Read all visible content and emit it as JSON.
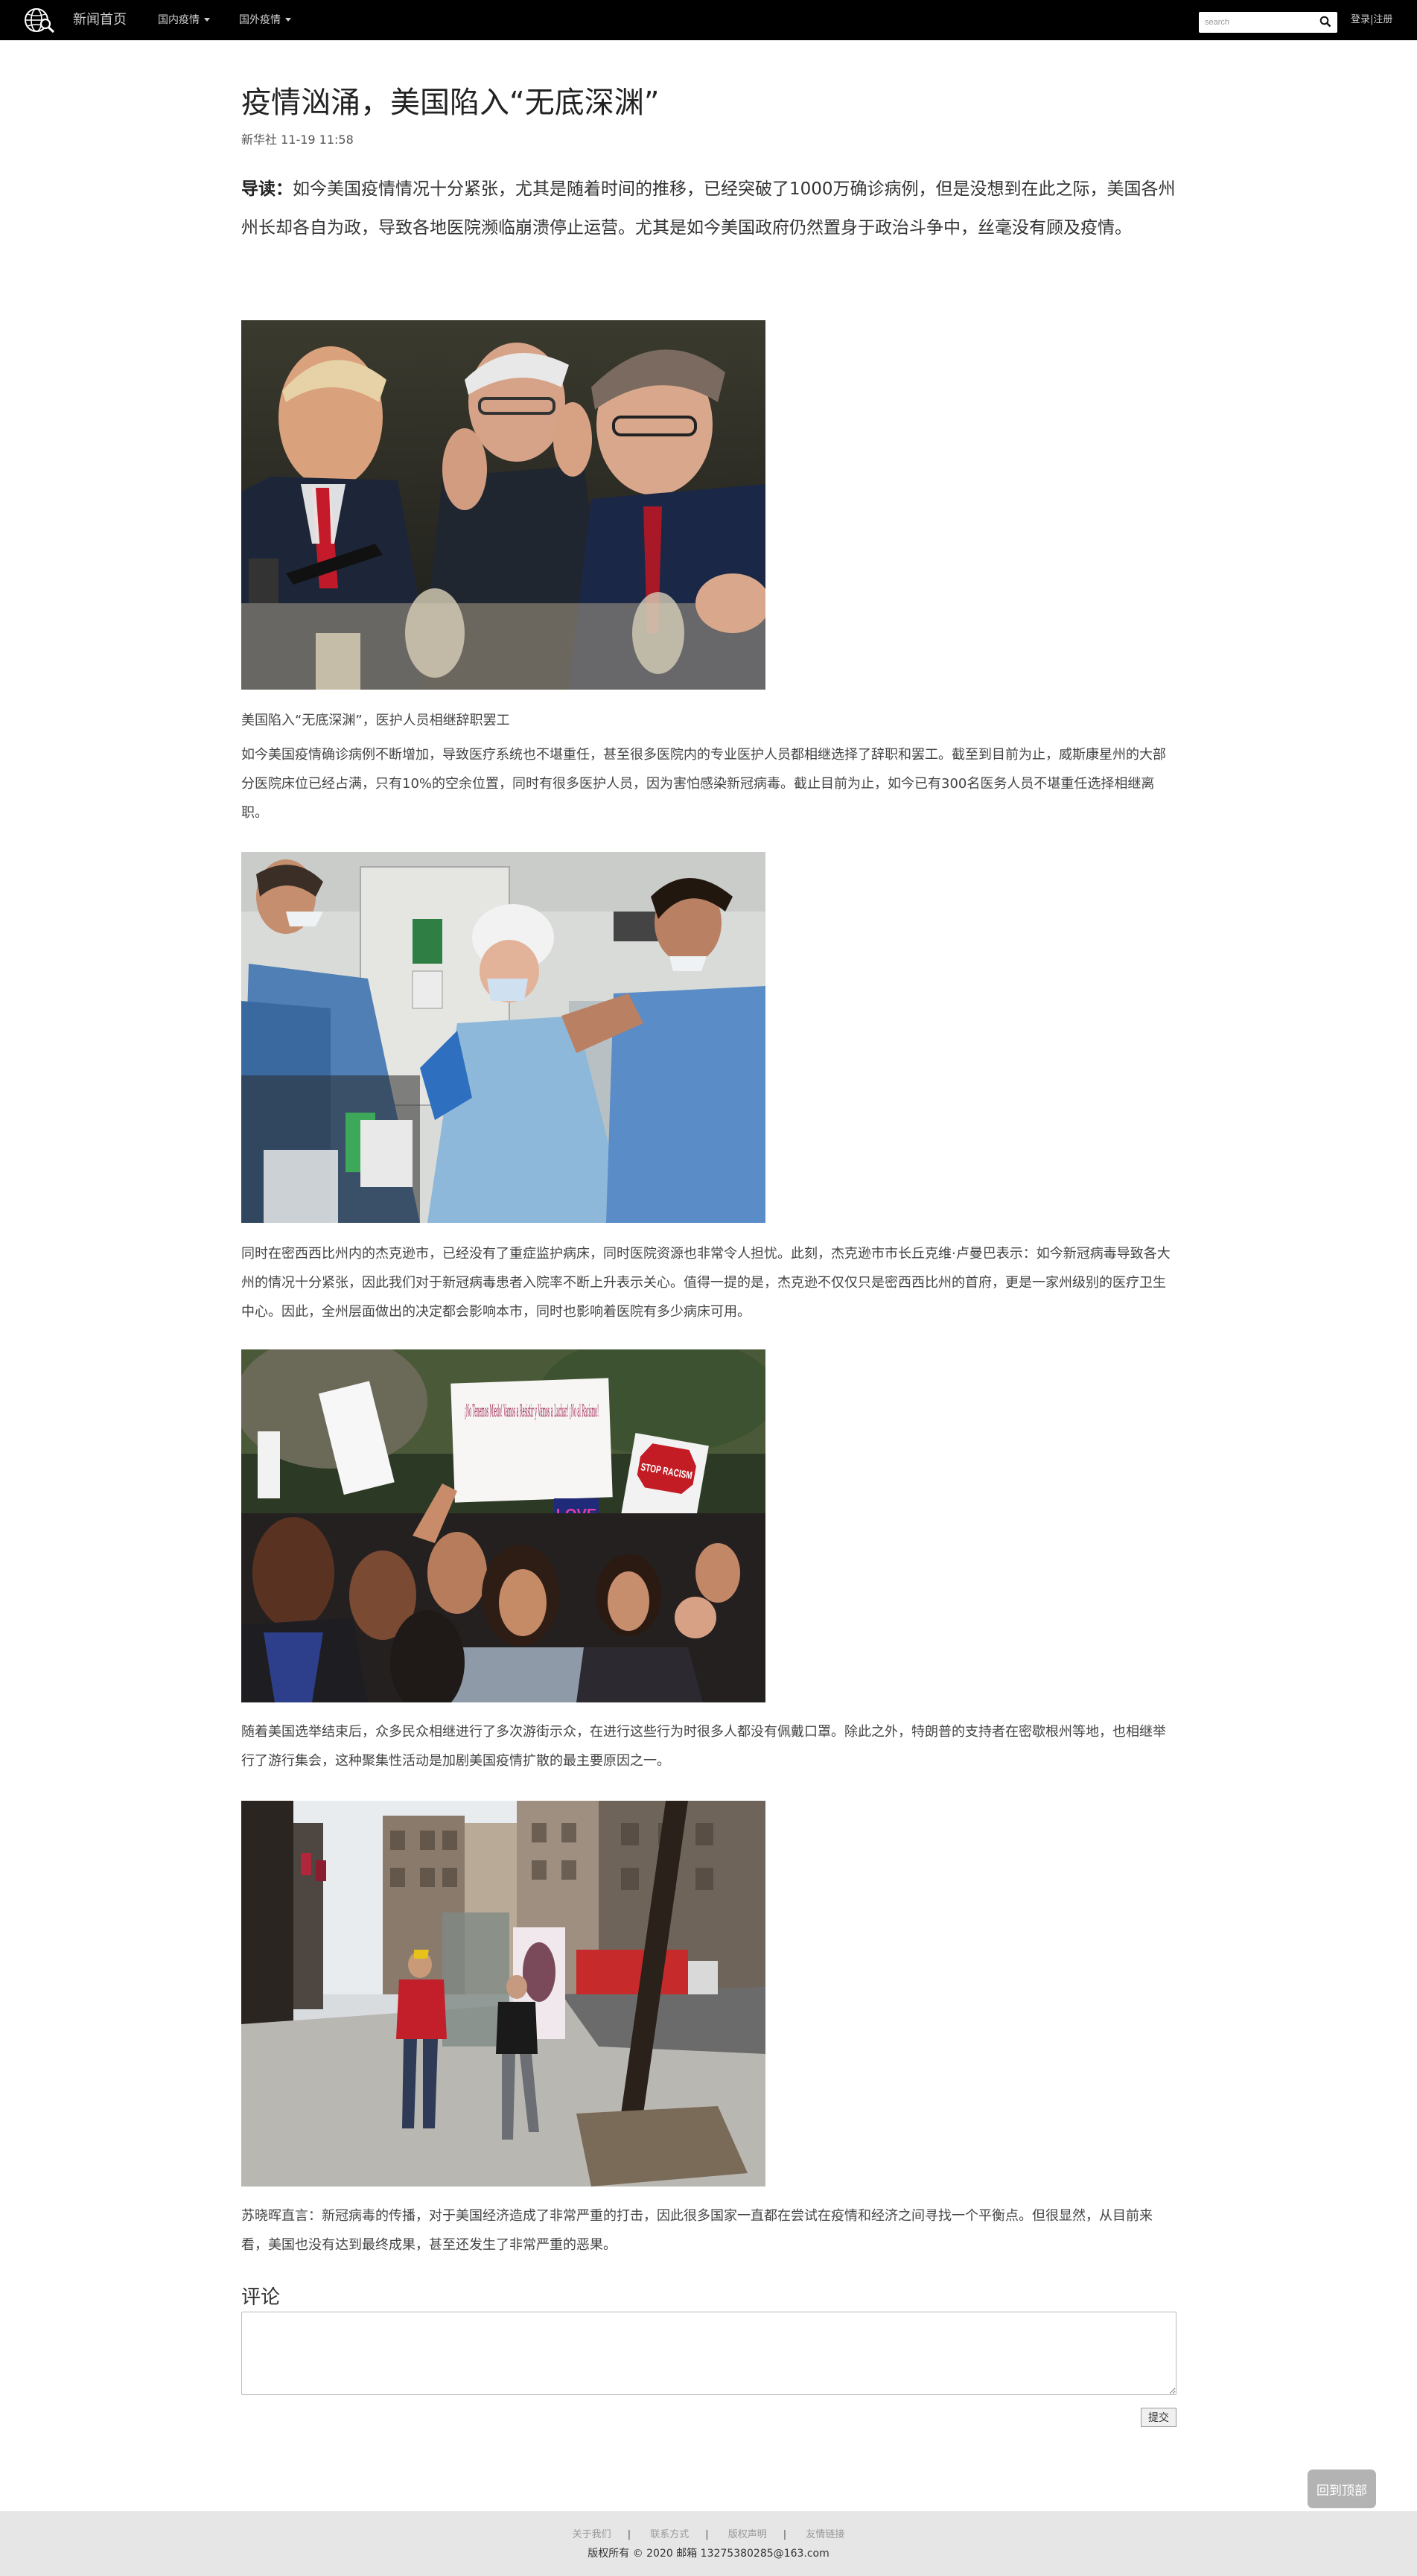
{
  "nav": {
    "home": "新闻首页",
    "domestic": "国内疫情",
    "foreign": "国外疫情",
    "search_placeholder": "search",
    "auth": "登录|注册"
  },
  "article": {
    "title": "疫情汹涌，美国陷入“无底深渊”",
    "meta": "新华社 11-19 11:58",
    "lead_label": "导读：",
    "lead_text": "如今美国疫情情况十分紧张，尤其是随着时间的推移，已经突破了1000万确诊病例，但是没想到在此之际，美国各州州长却各自为政，导致各地医院濒临崩溃停止运营。尤其是如今美国政府仍然置身于政治斗争中，丝毫没有顾及疫情。",
    "caption_1": "美国陷入“无底深渊”，医护人员相继辞职罢工",
    "para_1": "如今美国疫情确诊病例不断增加，导致医疗系统也不堪重任，甚至很多医院内的专业医护人员都相继选择了辞职和罢工。截至到目前为止，威斯康星州的大部分医院床位已经占满，只有10%的空余位置，同时有很多医护人员，因为害怕感染新冠病毒。截止目前为止，如今已有300名医务人员不堪重任选择相继离职。",
    "para_2": "同时在密西西比州内的杰克逊市，已经没有了重症监护病床，同时医院资源也非常令人担忧。此刻，杰克逊市市长丘克维·卢曼巴表示：如今新冠病毒导致各大州的情况十分紧张，因此我们对于新冠病毒患者入院率不断上升表示关心。值得一提的是，杰克逊不仅仅只是密西西比州的首府，更是一家州级别的医疗卫生中心。因此，全州层面做出的决定都会影响本市，同时也影响着医院有多少病床可用。",
    "para_3": "随着美国选举结束后，众多民众相继进行了多次游街示众，在进行这些行为时很多人都没有佩戴口罩。除此之外，特朗普的支持者在密歇根州等地，也相继举行了游行集会，这种聚集性活动是加剧美国疫情扩散的最主要原因之一。",
    "para_4": "苏晓晖直言：新冠病毒的传播，对于美国经济造成了非常严重的打击，因此很多国家一直都在尝试在疫情和经济之间寻找一个平衡点。但很显然，从目前来看，美国也没有达到最终成果，甚至还发生了非常严重的恶果。",
    "protest_signs": [
      "¡No Tenemos Miedo! Vamos a Resistir y Vamos a Luchar! ¡No al Racismo!",
      "STOP RACISM",
      "LOVE"
    ]
  },
  "comments": {
    "heading": "评论",
    "placeholder": "",
    "submit": "提交"
  },
  "back_to_top": "回到顶部",
  "footer": {
    "links": [
      "关于我们",
      "联系方式",
      "版权声明",
      "友情链接"
    ],
    "separator": "|",
    "copyright": "版权所有 © 2020  邮箱 13275380285@163.com"
  }
}
